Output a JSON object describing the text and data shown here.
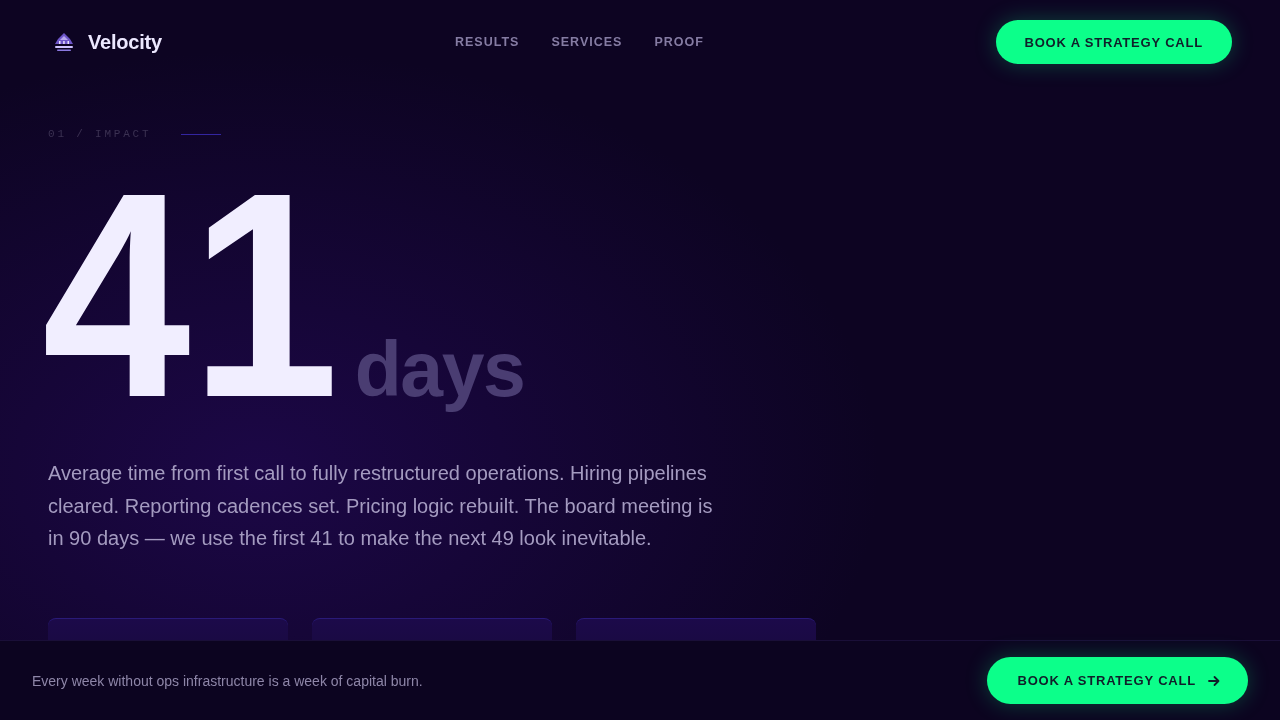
{
  "header": {
    "brand": "Velocity",
    "nav": [
      "RESULTS",
      "SERVICES",
      "PROOF"
    ],
    "cta": "BOOK A STRATEGY CALL"
  },
  "hero": {
    "eyebrow": "01 / IMPACT",
    "value": "41",
    "unit": "days",
    "description": "Average time from first call to fully restructured operations. Hiring pipelines cleared. Reporting cadences set. Pricing logic rebuilt. The board meeting is in 90 days — we use the first 41 to make the next 49 look inevitable."
  },
  "sticky_bar": {
    "message": "Every week without ops infrastructure is a week of capital burn.",
    "cta": "BOOK A STRATEGY CALL"
  }
}
